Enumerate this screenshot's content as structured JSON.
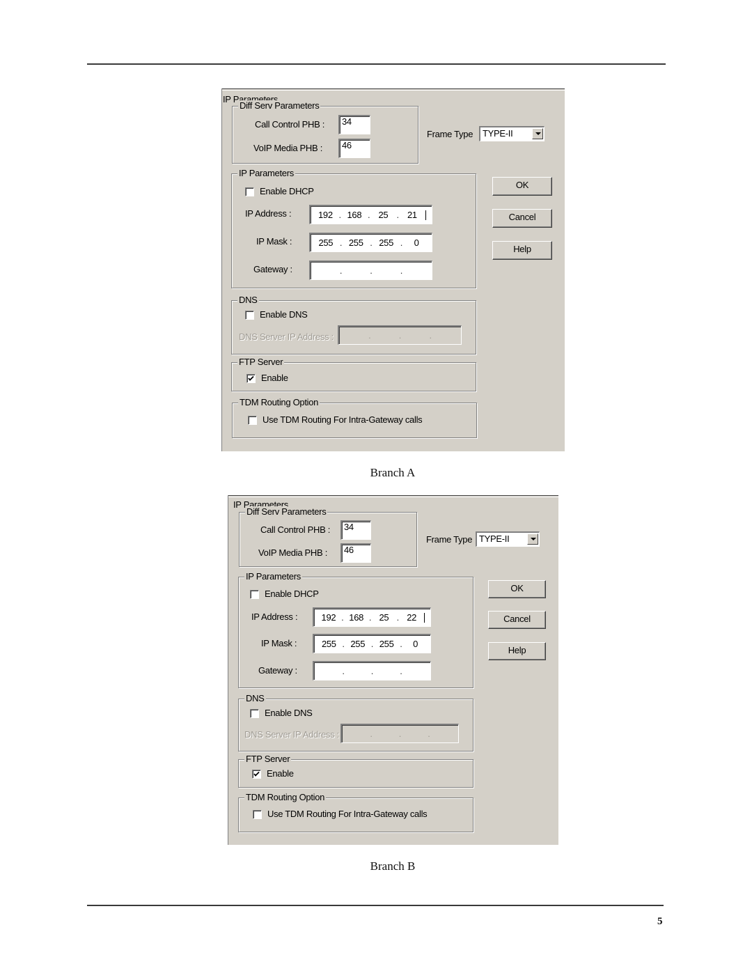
{
  "page_number": "5",
  "dialogs": [
    {
      "caption": "Branch A",
      "outer_group_title": "IP Parameters",
      "diffserv": {
        "title": "Diff Serv Parameters",
        "call_control_label": "Call Control PHB :",
        "call_control_value": "34",
        "voip_media_label": "VoIP Media PHB :",
        "voip_media_value": "46"
      },
      "frame_type": {
        "label": "Frame Type",
        "value": "TYPE-II"
      },
      "ip_params": {
        "title": "IP Parameters",
        "enable_dhcp_label": "Enable DHCP",
        "enable_dhcp_checked": false,
        "ip_address_label": "IP Address :",
        "ip_address": [
          "192",
          "168",
          "25",
          "21"
        ],
        "ip_mask_label": "IP Mask :",
        "ip_mask": [
          "255",
          "255",
          "255",
          "0"
        ],
        "gateway_label": "Gateway :",
        "gateway": [
          "",
          "",
          "",
          ""
        ]
      },
      "dns": {
        "title": "DNS",
        "enable_dns_label": "Enable DNS",
        "enable_dns_checked": false,
        "server_label": "DNS Server IP Address :",
        "server_ip": [
          "",
          "",
          "",
          ""
        ]
      },
      "ftp": {
        "title": "FTP Server",
        "enable_label": "Enable",
        "enable_checked": true
      },
      "tdm": {
        "title": "TDM Routing Option",
        "use_label": "Use TDM Routing For Intra-Gateway calls",
        "use_checked": false
      },
      "buttons": {
        "ok": "OK",
        "cancel": "Cancel",
        "help": "Help"
      }
    },
    {
      "caption": "Branch B",
      "outer_group_title": "IP Parameters",
      "diffserv": {
        "title": "Diff Serv Parameters",
        "call_control_label": "Call Control PHB :",
        "call_control_value": "34",
        "voip_media_label": "VoIP Media PHB :",
        "voip_media_value": "46"
      },
      "frame_type": {
        "label": "Frame Type",
        "value": "TYPE-II"
      },
      "ip_params": {
        "title": "IP Parameters",
        "enable_dhcp_label": "Enable DHCP",
        "enable_dhcp_checked": false,
        "ip_address_label": "IP Address :",
        "ip_address": [
          "192",
          "168",
          "25",
          "22"
        ],
        "ip_mask_label": "IP Mask :",
        "ip_mask": [
          "255",
          "255",
          "255",
          "0"
        ],
        "gateway_label": "Gateway :",
        "gateway": [
          "",
          "",
          "",
          ""
        ]
      },
      "dns": {
        "title": "DNS",
        "enable_dns_label": "Enable DNS",
        "enable_dns_checked": false,
        "server_label": "DNS Server IP Address :",
        "server_ip": [
          "",
          "",
          "",
          ""
        ]
      },
      "ftp": {
        "title": "FTP Server",
        "enable_label": "Enable",
        "enable_checked": true
      },
      "tdm": {
        "title": "TDM Routing Option",
        "use_label": "Use TDM Routing For Intra-Gateway calls",
        "use_checked": false
      },
      "buttons": {
        "ok": "OK",
        "cancel": "Cancel",
        "help": "Help"
      }
    }
  ]
}
